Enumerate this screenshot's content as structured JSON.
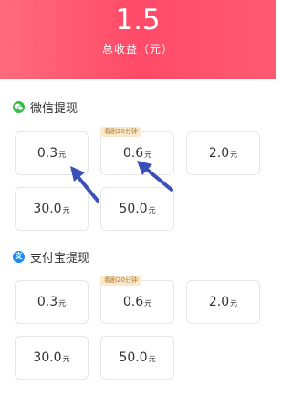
{
  "header": {
    "amount": "1.5",
    "label": "总收益（元）"
  },
  "unit": "元",
  "wechat": {
    "title": "微信提现",
    "options": [
      {
        "amount": "0.3"
      },
      {
        "amount": "0.6",
        "tag": "看剧20分钟"
      },
      {
        "amount": "2.0"
      },
      {
        "amount": "30.0"
      },
      {
        "amount": "50.0"
      }
    ]
  },
  "alipay": {
    "title": "支付宝提现",
    "icon_text": "支",
    "options": [
      {
        "amount": "0.3"
      },
      {
        "amount": "0.6",
        "tag": "看剧20分钟"
      },
      {
        "amount": "2.0"
      },
      {
        "amount": "30.0"
      },
      {
        "amount": "50.0"
      }
    ]
  },
  "colors": {
    "header_gradient": [
      "#ff6b7d",
      "#ff4a68"
    ],
    "wechat_green": "#2fbe46",
    "alipay_blue": "#1a8cf0",
    "tag_bg": "#fbe9cc",
    "tag_text": "#b07a33",
    "annotation_arrow": "#3a4fb8"
  }
}
